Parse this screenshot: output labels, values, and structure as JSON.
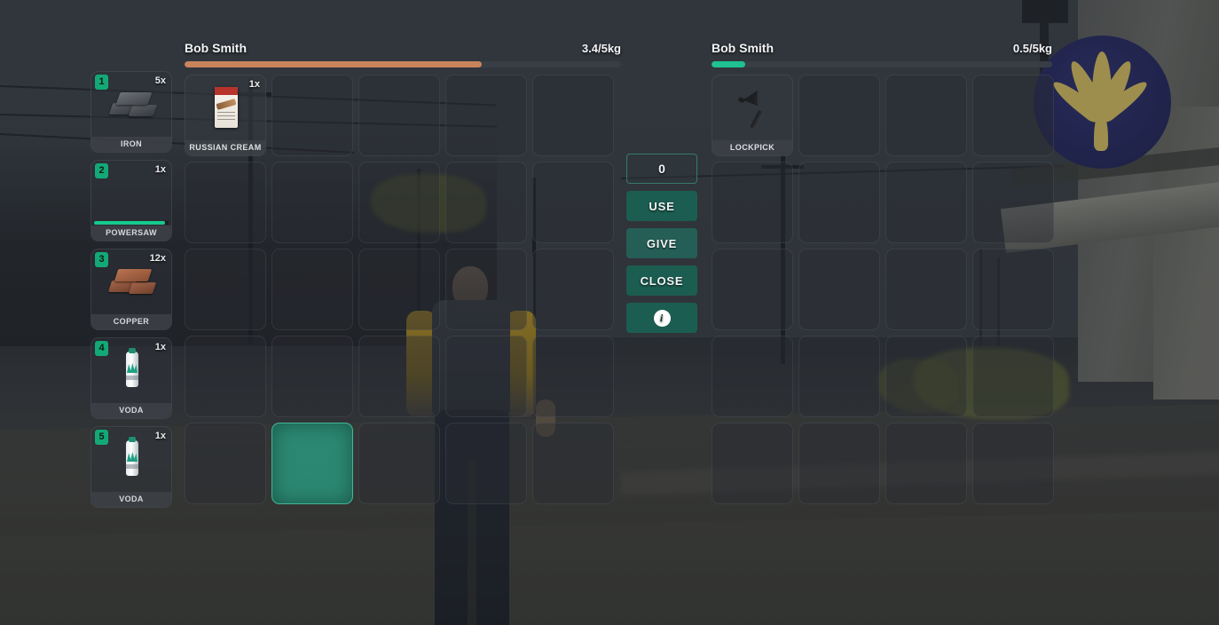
{
  "left_panel": {
    "owner_name": "Bob Smith",
    "weight_text": "3.4/5kg",
    "weight_percent": 68,
    "bar_color": "#c9845c",
    "grid_columns": 5,
    "grid_rows": 5,
    "slots": [
      {
        "index": 1,
        "label": "RUSSIAN CREAM",
        "qty": "1x",
        "icon": "cigar-pack-icon",
        "empty": false,
        "active": false
      },
      {
        "index": 2,
        "label": "",
        "qty": "",
        "icon": "",
        "empty": true,
        "active": false
      },
      {
        "index": 3,
        "label": "",
        "qty": "",
        "icon": "",
        "empty": true,
        "active": false
      },
      {
        "index": 4,
        "label": "",
        "qty": "",
        "icon": "",
        "empty": true,
        "active": false
      },
      {
        "index": 5,
        "label": "",
        "qty": "",
        "icon": "",
        "empty": true,
        "active": false
      },
      {
        "index": 6,
        "label": "",
        "qty": "",
        "icon": "",
        "empty": true,
        "active": false
      },
      {
        "index": 7,
        "label": "",
        "qty": "",
        "icon": "",
        "empty": true,
        "active": false
      },
      {
        "index": 8,
        "label": "",
        "qty": "",
        "icon": "",
        "empty": true,
        "active": false
      },
      {
        "index": 9,
        "label": "",
        "qty": "",
        "icon": "",
        "empty": true,
        "active": false
      },
      {
        "index": 10,
        "label": "",
        "qty": "",
        "icon": "",
        "empty": true,
        "active": false
      },
      {
        "index": 11,
        "label": "",
        "qty": "",
        "icon": "",
        "empty": true,
        "active": false
      },
      {
        "index": 12,
        "label": "",
        "qty": "",
        "icon": "",
        "empty": true,
        "active": false
      },
      {
        "index": 13,
        "label": "",
        "qty": "",
        "icon": "",
        "empty": true,
        "active": false
      },
      {
        "index": 14,
        "label": "",
        "qty": "",
        "icon": "",
        "empty": true,
        "active": false
      },
      {
        "index": 15,
        "label": "",
        "qty": "",
        "icon": "",
        "empty": true,
        "active": false
      },
      {
        "index": 16,
        "label": "",
        "qty": "",
        "icon": "",
        "empty": true,
        "active": false
      },
      {
        "index": 17,
        "label": "",
        "qty": "",
        "icon": "",
        "empty": true,
        "active": false
      },
      {
        "index": 18,
        "label": "",
        "qty": "",
        "icon": "",
        "empty": true,
        "active": false
      },
      {
        "index": 19,
        "label": "",
        "qty": "",
        "icon": "",
        "empty": true,
        "active": false
      },
      {
        "index": 20,
        "label": "",
        "qty": "",
        "icon": "",
        "empty": true,
        "active": false
      },
      {
        "index": 21,
        "label": "",
        "qty": "",
        "icon": "",
        "empty": true,
        "active": false
      },
      {
        "index": 22,
        "label": "",
        "qty": "",
        "icon": "",
        "empty": true,
        "active": true
      },
      {
        "index": 23,
        "label": "",
        "qty": "",
        "icon": "",
        "empty": true,
        "active": false
      },
      {
        "index": 24,
        "label": "",
        "qty": "",
        "icon": "",
        "empty": true,
        "active": false
      },
      {
        "index": 25,
        "label": "",
        "qty": "",
        "icon": "",
        "empty": true,
        "active": false
      }
    ]
  },
  "right_panel": {
    "owner_name": "Bob Smith",
    "weight_text": "0.5/5kg",
    "weight_percent": 10,
    "bar_color": "#1fc191",
    "grid_columns": 4,
    "grid_rows": 5,
    "slots": [
      {
        "index": 1,
        "label": "LOCKPICK",
        "qty": "",
        "icon": "lockpick-icon",
        "empty": false,
        "active": false
      },
      {
        "index": 2,
        "label": "",
        "qty": "",
        "icon": "",
        "empty": true,
        "active": false
      },
      {
        "index": 3,
        "label": "",
        "qty": "",
        "icon": "",
        "empty": true,
        "active": false
      },
      {
        "index": 4,
        "label": "",
        "qty": "",
        "icon": "",
        "empty": true,
        "active": false
      },
      {
        "index": 5,
        "label": "",
        "qty": "",
        "icon": "",
        "empty": true,
        "active": false
      },
      {
        "index": 6,
        "label": "",
        "qty": "",
        "icon": "",
        "empty": true,
        "active": false
      },
      {
        "index": 7,
        "label": "",
        "qty": "",
        "icon": "",
        "empty": true,
        "active": false
      },
      {
        "index": 8,
        "label": "",
        "qty": "",
        "icon": "",
        "empty": true,
        "active": false
      },
      {
        "index": 9,
        "label": "",
        "qty": "",
        "icon": "",
        "empty": true,
        "active": false
      },
      {
        "index": 10,
        "label": "",
        "qty": "",
        "icon": "",
        "empty": true,
        "active": false
      },
      {
        "index": 11,
        "label": "",
        "qty": "",
        "icon": "",
        "empty": true,
        "active": false
      },
      {
        "index": 12,
        "label": "",
        "qty": "",
        "icon": "",
        "empty": true,
        "active": false
      },
      {
        "index": 13,
        "label": "",
        "qty": "",
        "icon": "",
        "empty": true,
        "active": false
      },
      {
        "index": 14,
        "label": "",
        "qty": "",
        "icon": "",
        "empty": true,
        "active": false
      },
      {
        "index": 15,
        "label": "",
        "qty": "",
        "icon": "",
        "empty": true,
        "active": false
      },
      {
        "index": 16,
        "label": "",
        "qty": "",
        "icon": "",
        "empty": true,
        "active": false
      },
      {
        "index": 17,
        "label": "",
        "qty": "",
        "icon": "",
        "empty": true,
        "active": false
      },
      {
        "index": 18,
        "label": "",
        "qty": "",
        "icon": "",
        "empty": true,
        "active": false
      },
      {
        "index": 19,
        "label": "",
        "qty": "",
        "icon": "",
        "empty": true,
        "active": false
      },
      {
        "index": 20,
        "label": "",
        "qty": "",
        "icon": "",
        "empty": true,
        "active": false
      }
    ]
  },
  "hotbar": {
    "slots": [
      {
        "key": "1",
        "label": "IRON",
        "qty": "5x",
        "icon": "iron-ingot-icon",
        "durability": null
      },
      {
        "key": "2",
        "label": "POWERSAW",
        "qty": "1x",
        "icon": "powersaw-icon",
        "durability": 95
      },
      {
        "key": "3",
        "label": "COPPER",
        "qty": "12x",
        "icon": "copper-ingot-icon",
        "durability": null
      },
      {
        "key": "4",
        "label": "VODA",
        "qty": "1x",
        "icon": "water-bottle-icon",
        "durability": null
      },
      {
        "key": "5",
        "label": "VODA",
        "qty": "1x",
        "icon": "water-bottle-icon",
        "durability": null
      }
    ]
  },
  "actions": {
    "quantity_value": "0",
    "use_label": "USE",
    "give_label": "GIVE",
    "close_label": "CLOSE",
    "info_glyph": "i"
  },
  "theme": {
    "accent_teal": "#17c98d",
    "button_green": "#186858",
    "slot_bg": "#2c3036",
    "text_primary": "#f2f4f6",
    "weight_bar_left": "#c9845c",
    "weight_bar_right": "#1fc191"
  }
}
